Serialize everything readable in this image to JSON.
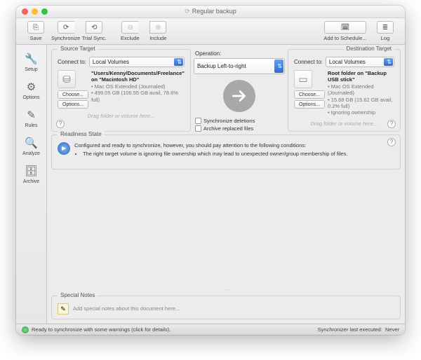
{
  "window": {
    "title": "Regular backup"
  },
  "toolbar": {
    "save": "Save",
    "synchronize": "Synchronize",
    "trial": "Trial Sync.",
    "exclude": "Exclude",
    "include": "Include",
    "schedule": "Add to Schedule...",
    "log": "Log"
  },
  "sidebar": {
    "items": [
      {
        "label": "Setup",
        "glyph": "🔧"
      },
      {
        "label": "Options",
        "glyph": "⚙"
      },
      {
        "label": "Rules",
        "glyph": "✎"
      },
      {
        "label": "Analyze",
        "glyph": "🔍"
      },
      {
        "label": "Archive",
        "glyph": "🗄"
      }
    ]
  },
  "source": {
    "group": "Source Target",
    "connect_label": "Connect to:",
    "connect_value": "Local Volumes",
    "path": "\"Users/Kenny/Documents/Freelance\" on \"Macintosh HD\"",
    "line1": "• Mac OS Extended (Journaled)",
    "line2": "• 499.05 GB (106.55 GB avail, 78.6% full)",
    "choose": "Choose...",
    "options": "Options...",
    "drop": "Drag folder or volume here..."
  },
  "operation": {
    "label": "Operation:",
    "value": "Backup Left-to-right",
    "sync_deletions": "Synchronize deletions",
    "archive_replaced": "Archive replaced files"
  },
  "dest": {
    "group": "Destination Target",
    "connect_label": "Connect to:",
    "connect_value": "Local Volumes",
    "path": "Root folder on \"Backup USB stick\"",
    "line1": "• Mac OS Extended (Journaled)",
    "line2": "• 15.68 GB (15.62 GB avail, 0.2% full)",
    "line3": "• Ignoring ownership",
    "choose": "Choose...",
    "options": "Options...",
    "drop": "Drag folder or volume here..."
  },
  "readiness": {
    "group": "Readiness State",
    "intro": "Configured and ready to synchronize, however, you should pay attention to the following conditions:",
    "bullet1": "The right target volume is ignoring file ownership which may lead to unexpected owner/group membership of files."
  },
  "notes": {
    "group": "Special Notes",
    "placeholder": "Add special notes about this document here..."
  },
  "status": {
    "left": "Ready to synchronize with some warnings (click for details).",
    "right_label": "Synchronizer last executed:",
    "right_value": "Never"
  },
  "help": "?"
}
